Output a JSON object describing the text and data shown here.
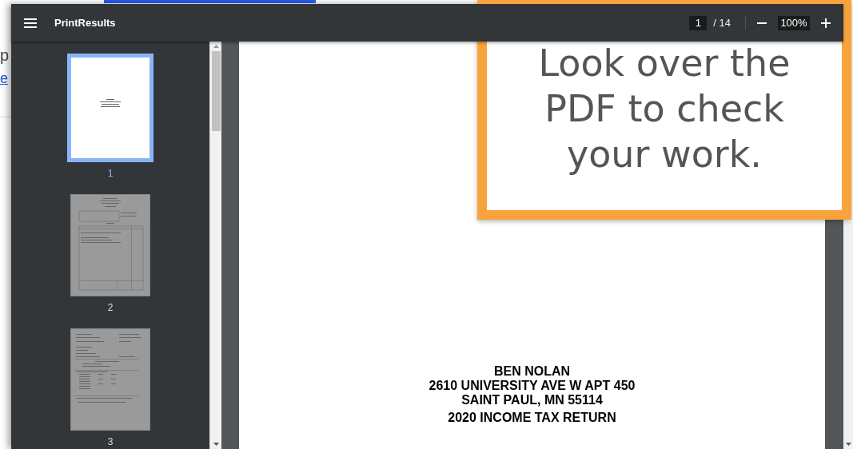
{
  "background_page": {
    "text_fragment": "p",
    "link_fragment": "e"
  },
  "viewer": {
    "title": "PrintResults",
    "page_input": "1",
    "page_total": "/ 14",
    "zoom_value": "100%",
    "thumbnails": [
      {
        "label": "1",
        "selected": true,
        "kind": "cover"
      },
      {
        "label": "2",
        "selected": false,
        "kind": "invoice"
      },
      {
        "label": "3",
        "selected": false,
        "kind": "statement"
      }
    ],
    "page_lines": [
      {
        "text": "BEN NOLAN",
        "kind": "address"
      },
      {
        "text": "2610 UNIVERSITY AVE W APT 450",
        "kind": "address"
      },
      {
        "text": "SAINT PAUL, MN 55114",
        "kind": "address"
      },
      {
        "text": "2020 INCOME TAX RETURN",
        "kind": "heading"
      }
    ]
  },
  "callout": {
    "text": "Look over the PDF to check your work."
  }
}
